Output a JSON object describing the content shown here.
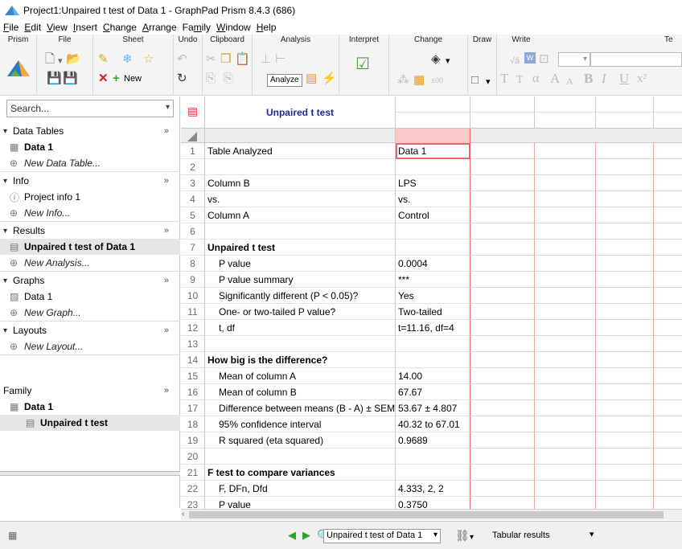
{
  "window": {
    "title": "Project1:Unpaired t test of Data 1 - GraphPad Prism 8.4.3 (686)"
  },
  "menu": [
    {
      "pre": "",
      "u": "F",
      "post": "ile"
    },
    {
      "pre": "",
      "u": "E",
      "post": "dit"
    },
    {
      "pre": "",
      "u": "V",
      "post": "iew"
    },
    {
      "pre": "",
      "u": "I",
      "post": "nsert"
    },
    {
      "pre": "",
      "u": "C",
      "post": "hange"
    },
    {
      "pre": "",
      "u": "A",
      "post": "rrange"
    },
    {
      "pre": "Fa",
      "u": "m",
      "post": "ily"
    },
    {
      "pre": "",
      "u": "W",
      "post": "indow"
    },
    {
      "pre": "",
      "u": "H",
      "post": "elp"
    }
  ],
  "ribbon": {
    "groups": [
      "Prism",
      "File",
      "Sheet",
      "Undo",
      "Clipboard",
      "Analysis",
      "Interpret",
      "Change",
      "Draw",
      "Write",
      "Te"
    ],
    "new_label": "New",
    "analyze_label": "Analyze",
    "font_glyphs": {
      "sqrt": "√ā",
      "tt": "T",
      "tt2": "T",
      "alpha": "α",
      "abig": "A",
      "asmall": "A",
      "bold": "B",
      "italic": "I",
      "underline": "U",
      "sup": "x²"
    }
  },
  "navigator": {
    "search_placeholder": "Search...",
    "sections": [
      {
        "label": "Data Tables",
        "items": [
          {
            "label": "Data 1",
            "bold": true,
            "icon": "table-icon"
          }
        ],
        "new": "New Data Table..."
      },
      {
        "label": "Info",
        "items": [
          {
            "label": "Project info 1",
            "bold": false,
            "icon": "info-icon"
          }
        ],
        "new": "New Info..."
      },
      {
        "label": "Results",
        "items": [
          {
            "label": "Unpaired t test of Data 1",
            "bold": true,
            "icon": "results-icon",
            "selected": true
          }
        ],
        "new": "New Analysis..."
      },
      {
        "label": "Graphs",
        "items": [
          {
            "label": "Data 1",
            "bold": false,
            "icon": "graph-icon"
          }
        ],
        "new": "New Graph..."
      },
      {
        "label": "Layouts",
        "items": [],
        "new": "New Layout..."
      }
    ],
    "family": {
      "label": "Family",
      "items": [
        {
          "label": "Data 1",
          "bold": true
        },
        {
          "label": "Unpaired t test",
          "bold": true,
          "selected": true
        }
      ]
    }
  },
  "sheet": {
    "title": "Unpaired t test",
    "rows": [
      {
        "n": "1",
        "label": "Table Analyzed",
        "value": "Data 1",
        "indent": false,
        "bold": false
      },
      {
        "n": "2",
        "label": "",
        "value": "",
        "indent": false,
        "bold": false
      },
      {
        "n": "3",
        "label": "Column B",
        "value": "LPS",
        "indent": false,
        "bold": false
      },
      {
        "n": "4",
        "label": "vs.",
        "value": "vs.",
        "indent": false,
        "bold": false
      },
      {
        "n": "5",
        "label": "Column A",
        "value": "Control",
        "indent": false,
        "bold": false
      },
      {
        "n": "6",
        "label": "",
        "value": "",
        "indent": false,
        "bold": false
      },
      {
        "n": "7",
        "label": "Unpaired t test",
        "value": "",
        "indent": false,
        "bold": true
      },
      {
        "n": "8",
        "label": "P value",
        "value": "0.0004",
        "indent": true,
        "bold": false
      },
      {
        "n": "9",
        "label": "P value summary",
        "value": "***",
        "indent": true,
        "bold": false
      },
      {
        "n": "10",
        "label": "Significantly different (P < 0.05)?",
        "value": "Yes",
        "indent": true,
        "bold": false
      },
      {
        "n": "11",
        "label": "One- or two-tailed P value?",
        "value": "Two-tailed",
        "indent": true,
        "bold": false
      },
      {
        "n": "12",
        "label": "t, df",
        "value": "t=11.16, df=4",
        "indent": true,
        "bold": false
      },
      {
        "n": "13",
        "label": "",
        "value": "",
        "indent": false,
        "bold": false
      },
      {
        "n": "14",
        "label": "How big is the difference?",
        "value": "",
        "indent": false,
        "bold": true
      },
      {
        "n": "15",
        "label": "Mean of column A",
        "value": "14.00",
        "indent": true,
        "bold": false
      },
      {
        "n": "16",
        "label": "Mean of column B",
        "value": "67.67",
        "indent": true,
        "bold": false
      },
      {
        "n": "17",
        "label": "Difference between means (B - A) ± SEM",
        "value": "53.67 ± 4.807",
        "indent": true,
        "bold": false
      },
      {
        "n": "18",
        "label": "95% confidence interval",
        "value": "40.32 to 67.01",
        "indent": true,
        "bold": false
      },
      {
        "n": "19",
        "label": "R squared (eta squared)",
        "value": "0.9689",
        "indent": true,
        "bold": false
      },
      {
        "n": "20",
        "label": "",
        "value": "",
        "indent": false,
        "bold": false
      },
      {
        "n": "21",
        "label": "F test to compare variances",
        "value": "",
        "indent": false,
        "bold": true
      },
      {
        "n": "22",
        "label": "F, DFn, Dfd",
        "value": "4.333, 2, 2",
        "indent": true,
        "bold": false
      },
      {
        "n": "23",
        "label": "P value",
        "value": "0.3750",
        "indent": true,
        "bold": false
      }
    ]
  },
  "statusbar": {
    "sheet_select": "Unpaired t test of Data 1",
    "view_label": "Tabular results"
  },
  "colors": {
    "accent_red": "#e06a6a",
    "selected_header": "#f9c9c9",
    "title_blue": "#1a2a9c"
  }
}
